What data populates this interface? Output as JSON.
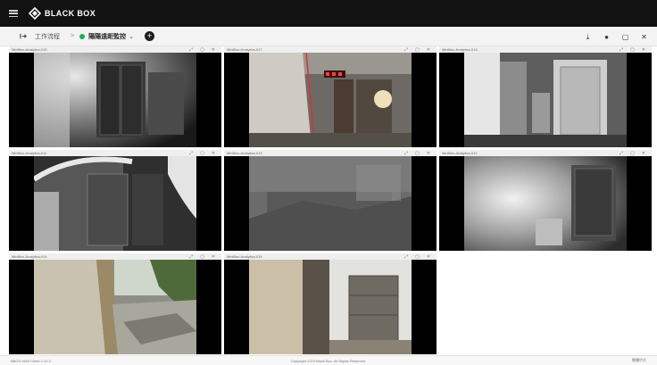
{
  "app": {
    "brand": "BLACK BOX"
  },
  "toolbar": {
    "breadcrumb_root": "工作流程",
    "separator": ">",
    "layout_name": "陽陽遠距監控",
    "dropdown_caret": "⌄",
    "add_label": "+",
    "status_color": "#22b14c"
  },
  "tiles": [
    {
      "title": "MiniBox-Analytics-015",
      "ctrl_a": "⤢",
      "ctrl_b": "▢",
      "ctrl_c": "✕",
      "scene": "cabinet-dark"
    },
    {
      "title": "MiniBox-Analytics-017",
      "ctrl_a": "⤢",
      "ctrl_b": "▢",
      "ctrl_c": "✕",
      "scene": "machinery-color"
    },
    {
      "title": "MiniBox-Analytics-019",
      "ctrl_a": "⤢",
      "ctrl_b": "▢",
      "ctrl_c": "✕",
      "scene": "electrical-room"
    },
    {
      "title": "MiniBox-Analytics-011",
      "ctrl_a": "⤢",
      "ctrl_b": "▢",
      "ctrl_c": "✕",
      "scene": "fisheye-cabinet"
    },
    {
      "title": "MiniBox-Analytics-013",
      "ctrl_a": "⤢",
      "ctrl_b": "▢",
      "ctrl_c": "✕",
      "scene": "gray-noise"
    },
    {
      "title": "MiniBox-Analytics-012",
      "ctrl_a": "⤢",
      "ctrl_b": "▢",
      "ctrl_c": "✕",
      "scene": "bright-corner"
    },
    {
      "title": "MiniBox-Analytics-014",
      "ctrl_a": "⤢",
      "ctrl_b": "▢",
      "ctrl_c": "✕",
      "scene": "outdoor-yard"
    },
    {
      "title": "MiniBox-Analytics-016",
      "ctrl_a": "⤢",
      "ctrl_b": "▢",
      "ctrl_c": "✕",
      "scene": "outdoor-door"
    }
  ],
  "footer": {
    "left": "BBOX-VMS Client 2.10.3",
    "center": "Copyright 2023 Black Box. All Rights Reserved.",
    "right": "繁體中文"
  }
}
